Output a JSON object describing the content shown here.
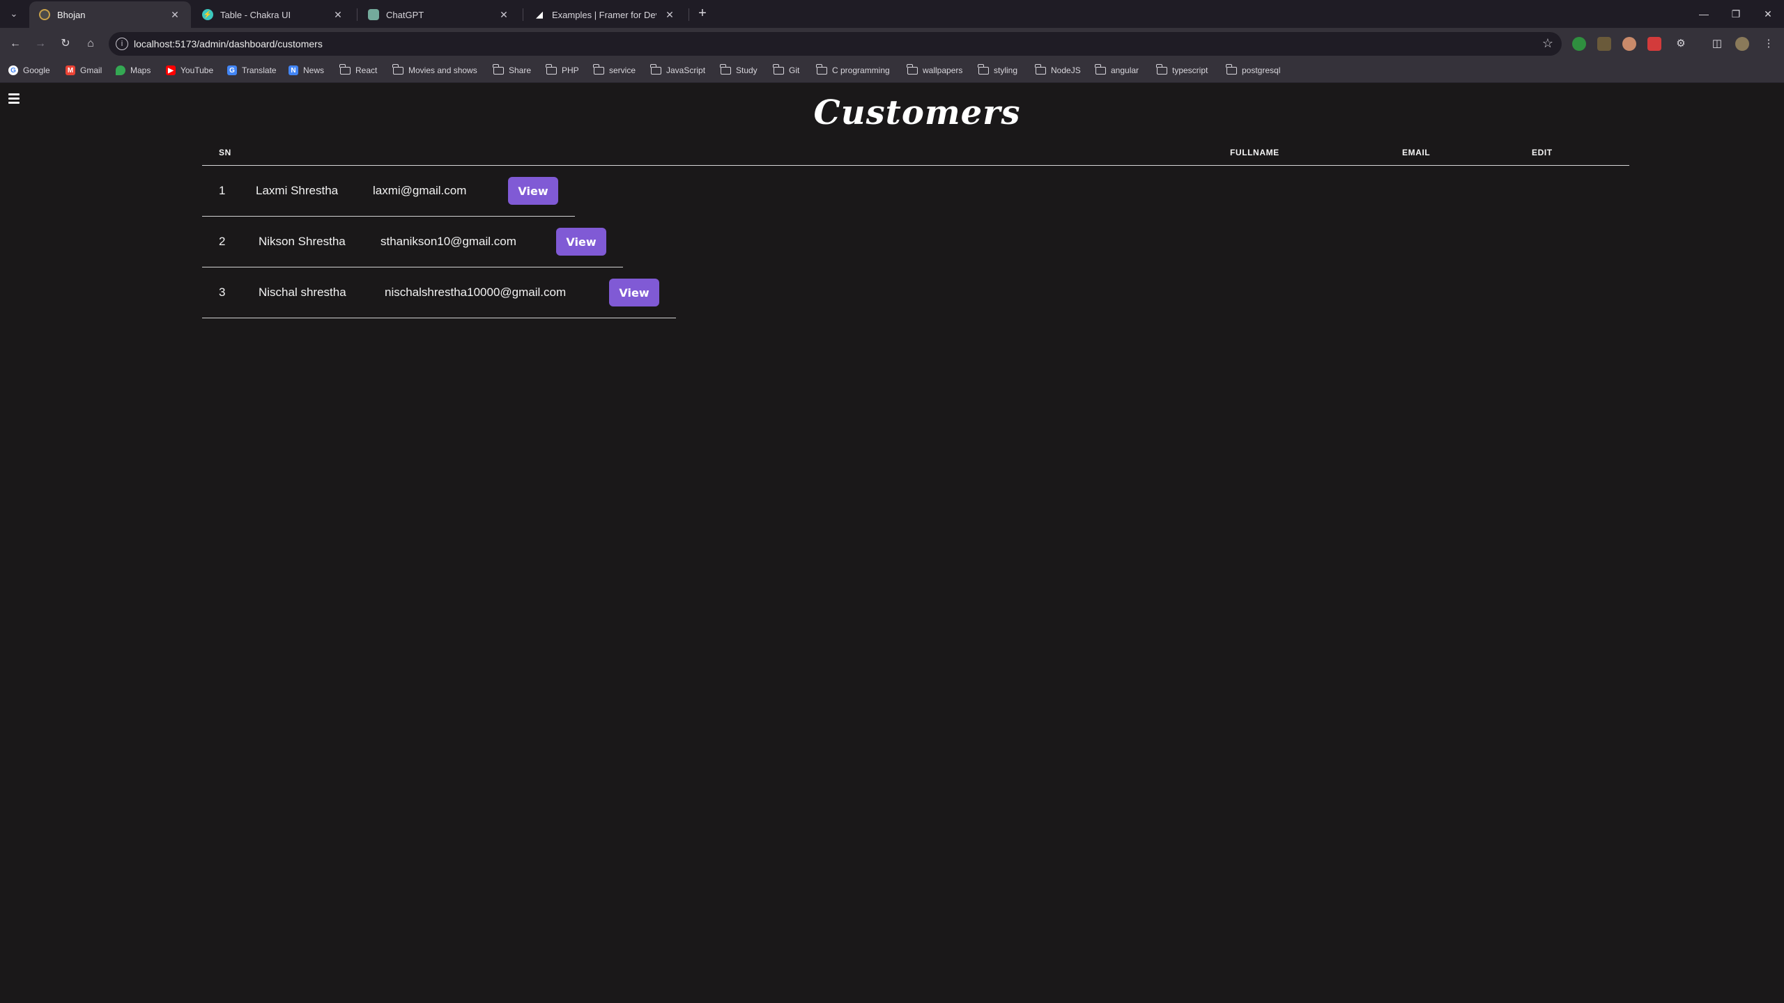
{
  "browser": {
    "tabs": [
      {
        "title": "Bhojan",
        "icon": "bhojan-favicon",
        "active": true
      },
      {
        "title": "Table - Chakra UI",
        "icon": "chakra-favicon",
        "active": false
      },
      {
        "title": "ChatGPT",
        "icon": "chatgpt-favicon",
        "active": false
      },
      {
        "title": "Examples | Framer for Develope",
        "icon": "framer-favicon",
        "active": false
      }
    ],
    "url": "localhost:5173/admin/dashboard/customers",
    "bookmarks": [
      {
        "label": "Google",
        "icon": "google-icon"
      },
      {
        "label": "Gmail",
        "icon": "gmail-icon"
      },
      {
        "label": "Maps",
        "icon": "maps-icon"
      },
      {
        "label": "YouTube",
        "icon": "youtube-icon"
      },
      {
        "label": "Translate",
        "icon": "translate-icon"
      },
      {
        "label": "News",
        "icon": "news-icon"
      },
      {
        "label": "React",
        "icon": "folder-icon"
      },
      {
        "label": "Movies and shows",
        "icon": "folder-icon"
      },
      {
        "label": "Share",
        "icon": "folder-icon"
      },
      {
        "label": "PHP",
        "icon": "folder-icon"
      },
      {
        "label": "service",
        "icon": "folder-icon"
      },
      {
        "label": "JavaScript",
        "icon": "folder-icon"
      },
      {
        "label": "Study",
        "icon": "folder-icon"
      },
      {
        "label": "Git",
        "icon": "folder-icon"
      },
      {
        "label": "C programming",
        "icon": "folder-icon"
      },
      {
        "label": "wallpapers",
        "icon": "folder-icon"
      },
      {
        "label": "styling",
        "icon": "folder-icon"
      },
      {
        "label": "NodeJS",
        "icon": "folder-icon"
      },
      {
        "label": "angular",
        "icon": "folder-icon"
      },
      {
        "label": "typescript",
        "icon": "folder-icon"
      },
      {
        "label": "postgresql",
        "icon": "folder-icon"
      }
    ]
  },
  "page": {
    "title": "Customers",
    "table": {
      "headers": {
        "sn": "SN",
        "fullname": "FULLNAME",
        "email": "EMAIL",
        "edit": "EDIT"
      },
      "rows": [
        {
          "sn": "1",
          "fullname": "Laxmi Shrestha",
          "email": "laxmi@gmail.com",
          "action": "View"
        },
        {
          "sn": "2",
          "fullname": "Nikson Shrestha",
          "email": "sthanikson10@gmail.com",
          "action": "View"
        },
        {
          "sn": "3",
          "fullname": "Nischal shrestha",
          "email": "nischalshrestha10000@gmail.com",
          "action": "View"
        }
      ]
    }
  },
  "colors": {
    "background": "#1a1819",
    "accent_button": "#805ad5",
    "tabstrip": "#1f1c25",
    "toolbar": "#35323a"
  }
}
